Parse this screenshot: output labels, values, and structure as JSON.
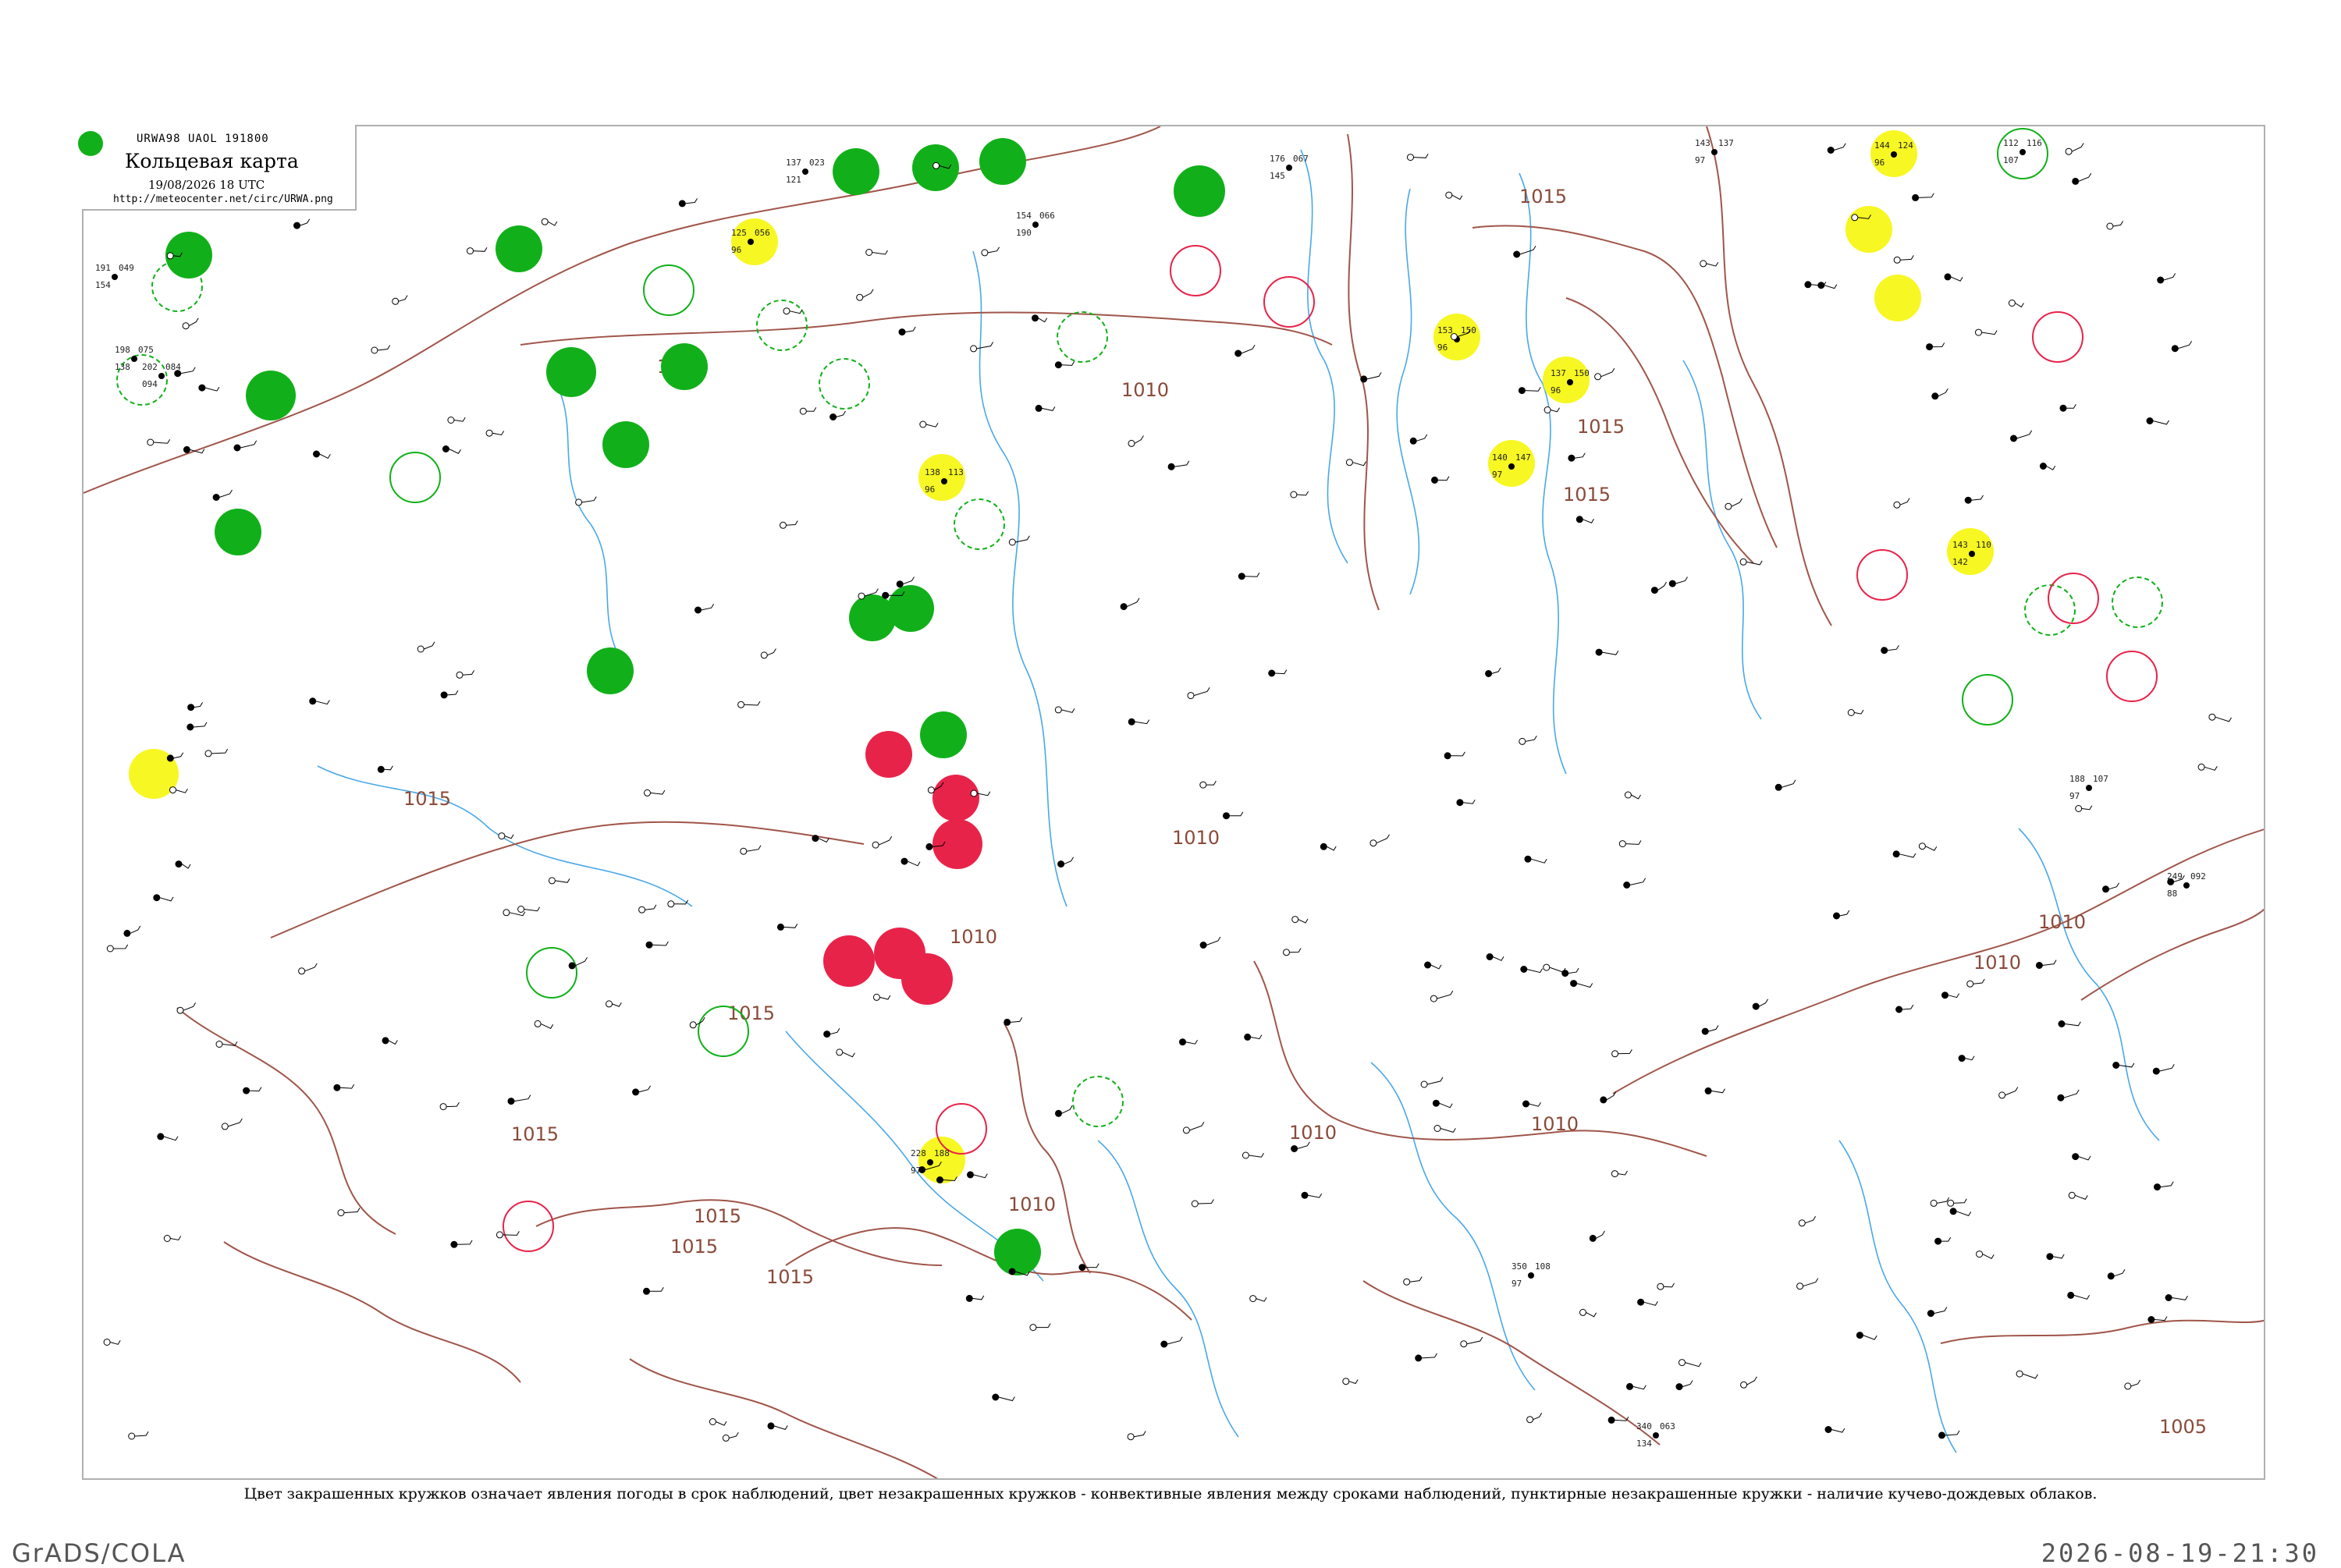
{
  "header": {
    "code": "URWA98  UAOL  191800",
    "title": "Кольцевая карта",
    "time": "19/08/2026 18 UTC",
    "url": "http://meteocenter.net/circ/URWA.png"
  },
  "caption": "Цвет закрашенных кружков означает явления погоды в срок наблюдений, цвет незакрашенных кружков - конвективные явления между сроками наблюдений, пунктирные незакрашенные кружки - наличие кучево-дождевых облаков.",
  "footer": {
    "left": "GrADS/COLA",
    "right": "2026-08-19-21:30"
  },
  "colors": {
    "rain": "#11b01a",
    "thunder": "#e8234a",
    "haze": "#f7f723",
    "isobar": "#a0554a",
    "river": "#4aa8e8"
  },
  "isobar_labels": [
    "1015",
    "1015",
    "1010",
    "1015",
    "1015",
    "1010",
    "1015",
    "1010",
    "1010",
    "1015",
    "1010",
    "1015",
    "1015",
    "1015",
    "1010",
    "1010",
    "1010",
    "1010",
    "1005"
  ],
  "stations": [
    {
      "p": "191",
      "t": "049",
      "w": "154"
    },
    {
      "p": "198",
      "t": "075",
      "w": "138"
    },
    {
      "p": "202",
      "t": "084",
      "w": "094"
    },
    {
      "p": "125",
      "t": "056",
      "w": "96"
    },
    {
      "p": "137",
      "t": "023",
      "w": "121"
    },
    {
      "p": "154",
      "t": "066",
      "w": "190"
    },
    {
      "p": "176",
      "t": "067",
      "w": "145"
    },
    {
      "p": "143",
      "t": "137",
      "w": "97"
    },
    {
      "p": "144",
      "t": "124",
      "w": "96"
    },
    {
      "p": "112",
      "t": "116",
      "w": "107"
    },
    {
      "p": "153",
      "t": "150",
      "w": "96"
    },
    {
      "p": "137",
      "t": "150",
      "w": "96"
    },
    {
      "p": "140",
      "t": "147",
      "w": "97"
    },
    {
      "p": "138",
      "t": "113",
      "w": "96"
    },
    {
      "p": "143",
      "t": "110",
      "w": "142"
    },
    {
      "p": "188",
      "t": "107",
      "w": "97"
    },
    {
      "p": "228",
      "t": "188",
      "w": "97"
    },
    {
      "p": "249",
      "t": "092",
      "w": "88"
    },
    {
      "p": "350",
      "t": "108",
      "w": "97"
    },
    {
      "p": "340",
      "t": "063",
      "w": "134"
    }
  ]
}
